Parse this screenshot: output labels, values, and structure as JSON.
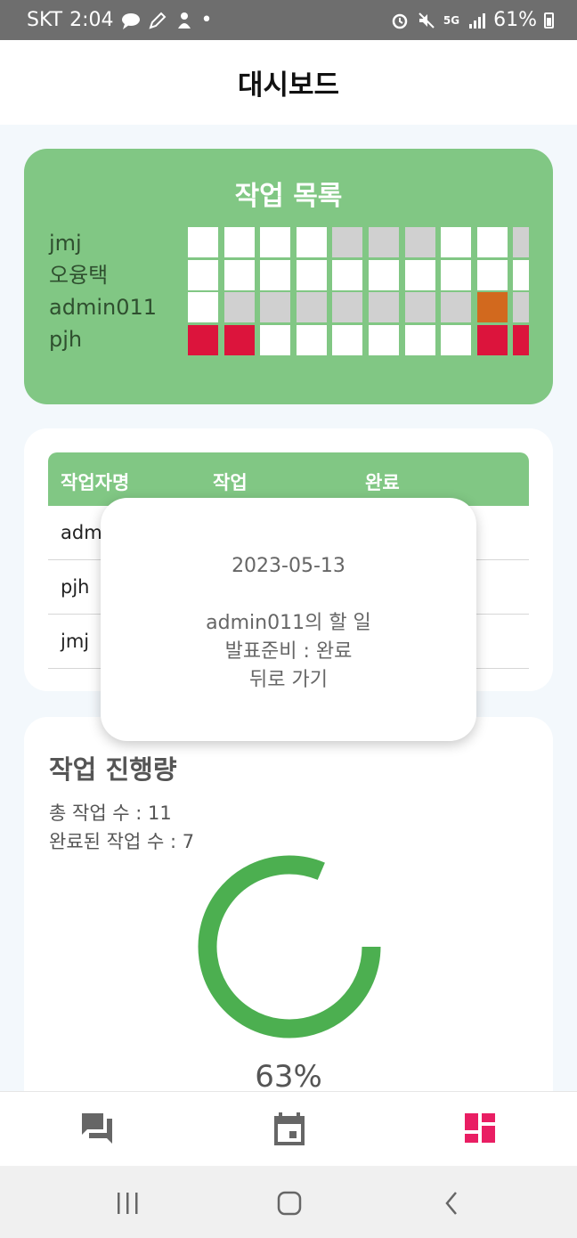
{
  "status_bar": {
    "carrier": "SKT",
    "time": "2:04",
    "dot": "•",
    "network": "5G",
    "battery": "61%",
    "icons_left": [
      "chat-bubble-icon",
      "pencil-icon",
      "app-icon"
    ],
    "icons_right": [
      "alarm-icon",
      "mute-icon",
      "signal-icon",
      "battery-icon"
    ]
  },
  "header": {
    "title": "대시보드"
  },
  "task_list": {
    "title": "작업 목록",
    "users": [
      "jmj",
      "오융택",
      "admin011",
      "pjh"
    ],
    "grid": [
      [
        "white",
        "white",
        "white",
        "white",
        "gray",
        "gray",
        "gray",
        "white",
        "white",
        "gray"
      ],
      [
        "white",
        "white",
        "white",
        "white",
        "white",
        "white",
        "white",
        "white",
        "white",
        "white"
      ],
      [
        "white",
        "gray",
        "gray",
        "gray",
        "gray",
        "gray",
        "gray",
        "gray",
        "orange",
        "gray"
      ],
      [
        "red",
        "red",
        "white",
        "white",
        "white",
        "white",
        "white",
        "white",
        "red",
        "red"
      ]
    ],
    "colors": {
      "white": "#ffffff",
      "gray": "#d0d0d0",
      "orange": "#d2691e",
      "red": "#dc143c"
    }
  },
  "table": {
    "headers": [
      "작업자명",
      "작업",
      "완료"
    ],
    "rows": [
      {
        "name": "adm"
      },
      {
        "name": "pjh"
      },
      {
        "name": "jmj"
      }
    ]
  },
  "popup": {
    "date": "2023-05-13",
    "line1": "admin011의 할 일",
    "line2": "발표준비 : 완료",
    "back": "뒤로 가기"
  },
  "progress": {
    "title": "작업 진행량",
    "total_label": "총 작업 수 : 11",
    "done_label": "완료된 작업 수 : 7",
    "total": 11,
    "done": 7,
    "percent_text": "63%",
    "ring_color": "#4caf50"
  },
  "bottom_nav": {
    "items": [
      {
        "icon": "chat-forum-icon",
        "active": false
      },
      {
        "icon": "calendar-icon",
        "active": false
      },
      {
        "icon": "dashboard-icon",
        "active": true
      }
    ],
    "active_color": "#e91e63",
    "inactive_color": "#666666"
  },
  "system_nav": {
    "icons": [
      "recent-apps-icon",
      "home-icon",
      "back-icon"
    ]
  }
}
